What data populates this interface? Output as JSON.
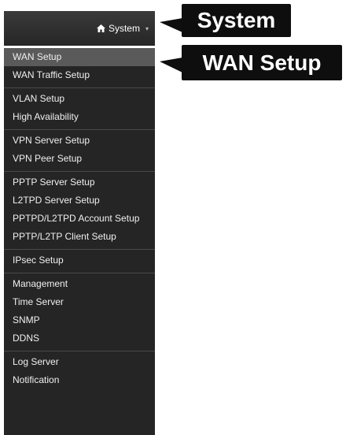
{
  "header": {
    "dropdown_label": "System",
    "home_icon": "home-icon",
    "caret_icon": "caret-down-icon"
  },
  "sidebar": {
    "groups": [
      {
        "items": [
          "WAN Setup",
          "WAN Traffic Setup"
        ]
      },
      {
        "items": [
          "VLAN Setup",
          "High Availability"
        ]
      },
      {
        "items": [
          "VPN Server Setup",
          "VPN Peer Setup"
        ]
      },
      {
        "items": [
          "PPTP Server Setup",
          "L2TPD Server Setup",
          "PPTPD/L2TPD Account Setup",
          "PPTP/L2TP Client Setup"
        ]
      },
      {
        "items": [
          "IPsec Setup"
        ]
      },
      {
        "items": [
          "Management",
          "Time Server",
          "SNMP",
          "DDNS"
        ]
      },
      {
        "items": [
          "Log Server",
          "Notification"
        ]
      }
    ],
    "active_item": "WAN Setup"
  },
  "callouts": {
    "system": "System",
    "wan_setup": "WAN Setup"
  },
  "colors": {
    "sidebar_bg": "#252525",
    "active_bg": "#5a5a5a",
    "callout_bg": "#0e0e0e",
    "text": "#f0f0f0"
  }
}
